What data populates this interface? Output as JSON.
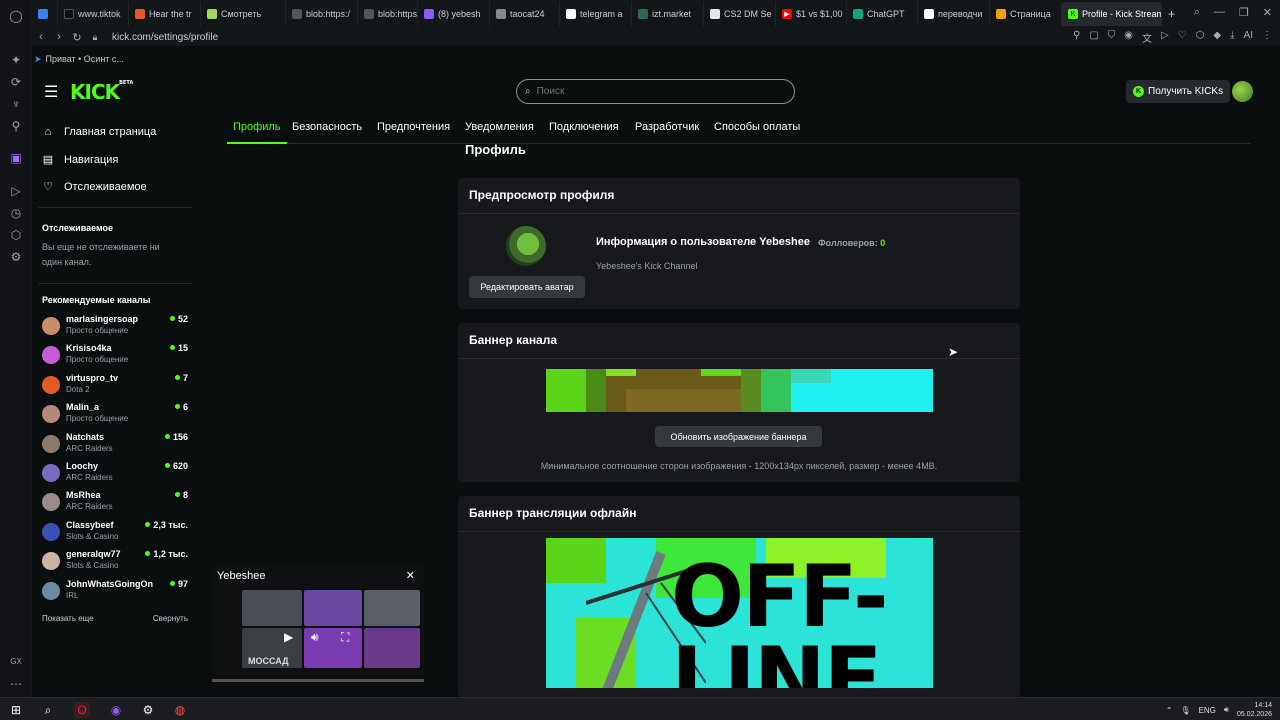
{
  "browser": {
    "tabs": [
      {
        "label": "",
        "color": "#3b82f6"
      },
      {
        "label": "www.tiktok",
        "color": "#111111"
      },
      {
        "label": "Hear the tr",
        "color": "#e05a2b"
      },
      {
        "label": "Смотреть",
        "color": "#a3d65c"
      },
      {
        "label": "blob:https:/",
        "color": "#555555"
      },
      {
        "label": "blob:https:/",
        "color": "#555555"
      },
      {
        "label": "(8) yebesh",
        "color": "#8b5cf6"
      },
      {
        "label": "taocat24",
        "color": "#888888"
      },
      {
        "label": "telegram a",
        "color": "#ffffff"
      },
      {
        "label": "izt.market",
        "color": "#2d6a4f"
      },
      {
        "label": "CS2 DM Se",
        "color": "#e5e7eb"
      },
      {
        "label": "$1 vs $1,00",
        "color": "#ff0000"
      },
      {
        "label": "ChatGPT",
        "color": "#10a37f"
      },
      {
        "label": "переводчи",
        "color": "#ffffff"
      },
      {
        "label": "Страница",
        "color": "#f59e0b"
      },
      {
        "label": "Profile - Kick Stream",
        "color": "#53fc18"
      }
    ],
    "url": "kick.com/settings/profile",
    "bookmark": "Приват • Осинт с..."
  },
  "header": {
    "logo": "KICK",
    "logo_beta": "BETA",
    "search_placeholder": "Поиск",
    "kicks_button": "Получить KICKs"
  },
  "sidebar": {
    "nav": [
      {
        "label": "Главная страница",
        "icon": "home-icon"
      },
      {
        "label": "Навигация",
        "icon": "browse-icon"
      },
      {
        "label": "Отслеживаемое",
        "icon": "heart-icon"
      }
    ],
    "following_title": "Отслеживаемое",
    "following_empty": "Вы еще не отслеживаете ни один канал.",
    "recommended_title": "Рекомендуемые каналы",
    "channels": [
      {
        "name": "marlasingersoap",
        "category": "Просто общение",
        "viewers": "52",
        "color": "#c98d6c"
      },
      {
        "name": "Krisiso4ka",
        "category": "Просто общение",
        "viewers": "15",
        "color": "#c65dd6"
      },
      {
        "name": "virtuspro_tv",
        "category": "Dota 2",
        "viewers": "7",
        "color": "#e25b25"
      },
      {
        "name": "Malin_a",
        "category": "Просто общение",
        "viewers": "6",
        "color": "#b58a7c"
      },
      {
        "name": "Natchats",
        "category": "ARC Raiders",
        "viewers": "156",
        "color": "#8d7a6a"
      },
      {
        "name": "Loochy",
        "category": "ARC Raiders",
        "viewers": "620",
        "color": "#7a6ac0"
      },
      {
        "name": "MsRhea",
        "category": "ARC Raiders",
        "viewers": "8",
        "color": "#9a8a8a"
      },
      {
        "name": "Classybeef",
        "category": "Slots & Casino",
        "viewers": "2,3 тыс.",
        "color": "#3b4fb8"
      },
      {
        "name": "generalqw77",
        "category": "Slots & Casino",
        "viewers": "1,2 тыс.",
        "color": "#c7b6a6"
      },
      {
        "name": "JohnWhatsGoingOn",
        "category": "IRL",
        "viewers": "97",
        "color": "#6b8aa6"
      }
    ],
    "show_more": "Показать еще",
    "collapse": "Свернуть"
  },
  "settings_tabs": [
    "Профиль",
    "Безопасность",
    "Предпочтения",
    "Уведомления",
    "Подключения",
    "Разработчик",
    "Способы оплаты"
  ],
  "main": {
    "title": "Профиль",
    "preview": {
      "heading": "Предпросмотр профиля",
      "user_info": "Информация о пользователе Yebeshee",
      "followers_label": "Фолловеров:",
      "followers_count": "0",
      "channel_desc": "Yebeshee's Kick Channel",
      "edit_avatar": "Редактировать аватар"
    },
    "banner": {
      "heading": "Баннер канала",
      "update_button": "Обновить изображение баннера",
      "note": "Минимальное соотношение сторон изображения - 1200x134px пикселей, размер - менее 4MB."
    },
    "offline": {
      "heading": "Баннер трансляции офлайн",
      "image_text": "OFF-LINE"
    }
  },
  "mini_player": {
    "title": "Yebeshee",
    "thumb_text": "МОССАД"
  },
  "taskbar": {
    "lang": "ENG",
    "time": "14:14",
    "date": "05.02.2026"
  }
}
